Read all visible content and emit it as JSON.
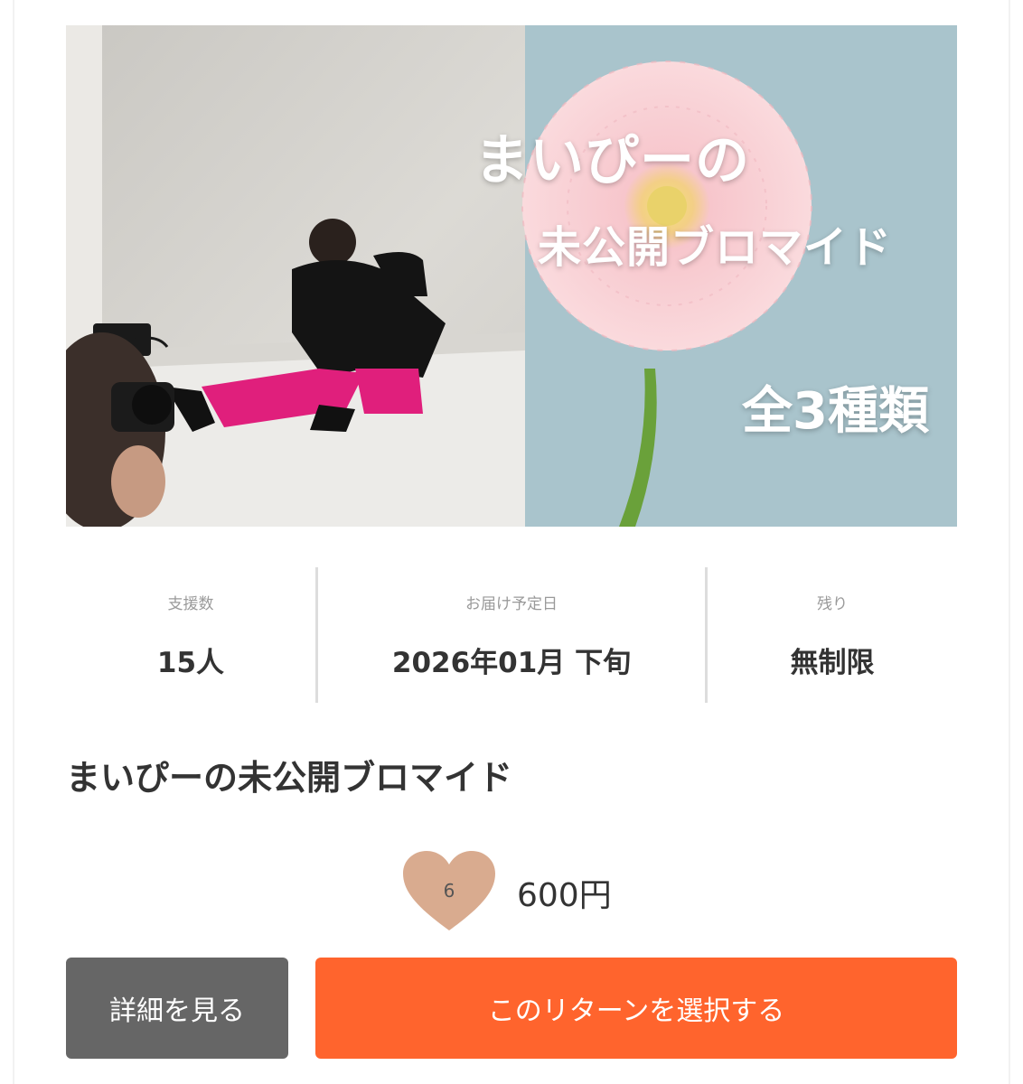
{
  "hero": {
    "title_line1": "まいぴーの",
    "title_line2": "未公開ブロマイド",
    "title_line3": "全3種類",
    "colors": {
      "sky": "#a9c4cc",
      "wall": "#d6d4cf",
      "pants": "#e01f7c",
      "stem": "#6aa13a",
      "petal": "#f6c9cf"
    }
  },
  "stats": [
    {
      "label": "支援数",
      "value": "15人"
    },
    {
      "label": "お届け予定日",
      "value": "2026年01月 下旬"
    },
    {
      "label": "残り",
      "value": "無制限"
    }
  ],
  "reward": {
    "title": "まいぴーの未公開ブロマイド",
    "like_count": "6",
    "price": "600円",
    "heart_color": "#d9ab8f"
  },
  "buttons": {
    "detail_label": "詳細を見る",
    "select_label": "このリターンを選択する",
    "select_color": "#ff642d"
  }
}
